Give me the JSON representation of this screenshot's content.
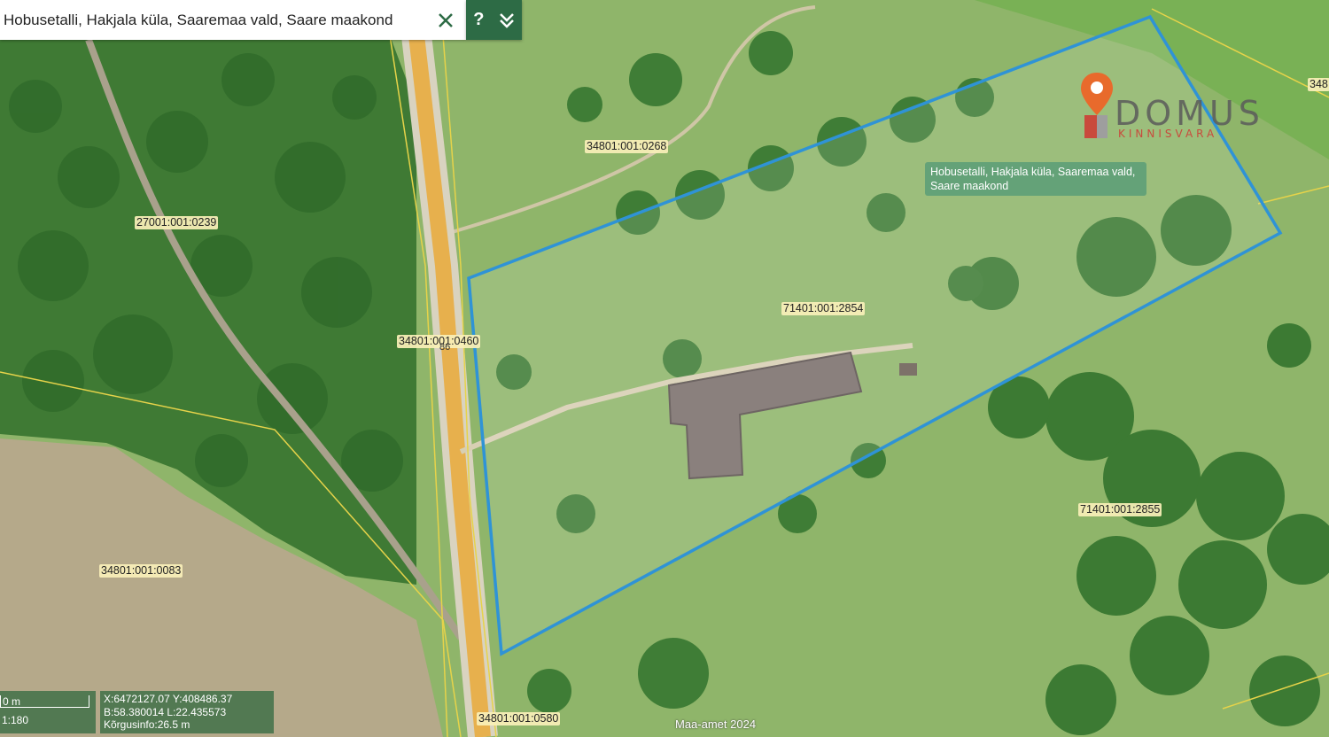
{
  "search": {
    "value": "Hobusetalli, Hakjala küla, Saaremaa vald, Saare maakond",
    "clear_icon": "close-icon",
    "help_label": "?",
    "expand_icon": "chevrons-down-icon"
  },
  "map": {
    "parcels": [
      {
        "id": "34801:001:0268"
      },
      {
        "id": "27001:001:0239"
      },
      {
        "id": "71401:001:2854"
      },
      {
        "id": "34801:001:0460",
        "display": "34801:001:0460"
      },
      {
        "id": "34801:001:0083"
      },
      {
        "id": "71401:001:2855"
      },
      {
        "id": "34801:001:0580"
      },
      {
        "id": "348",
        "display": "348"
      }
    ],
    "road_number": "86",
    "selected_property": "Hobusetalli, Hakjala küla, Saaremaa vald, Saare maakond",
    "boundary_color": "#2f93d6"
  },
  "logo": {
    "name": "DOMUS",
    "subtitle": "KINNISVARA",
    "icon": "map-pin-icon",
    "accent_color": "#e86a2c"
  },
  "scale": {
    "distance": "0 m",
    "ratio": "1:180"
  },
  "coords": {
    "xy": "X:6472127.07 Y:408486.37",
    "bl": "B:58.380014 L:22.435573",
    "height": "Kõrgusinfo:26.5 m"
  },
  "attribution": "Maa-amet 2024"
}
